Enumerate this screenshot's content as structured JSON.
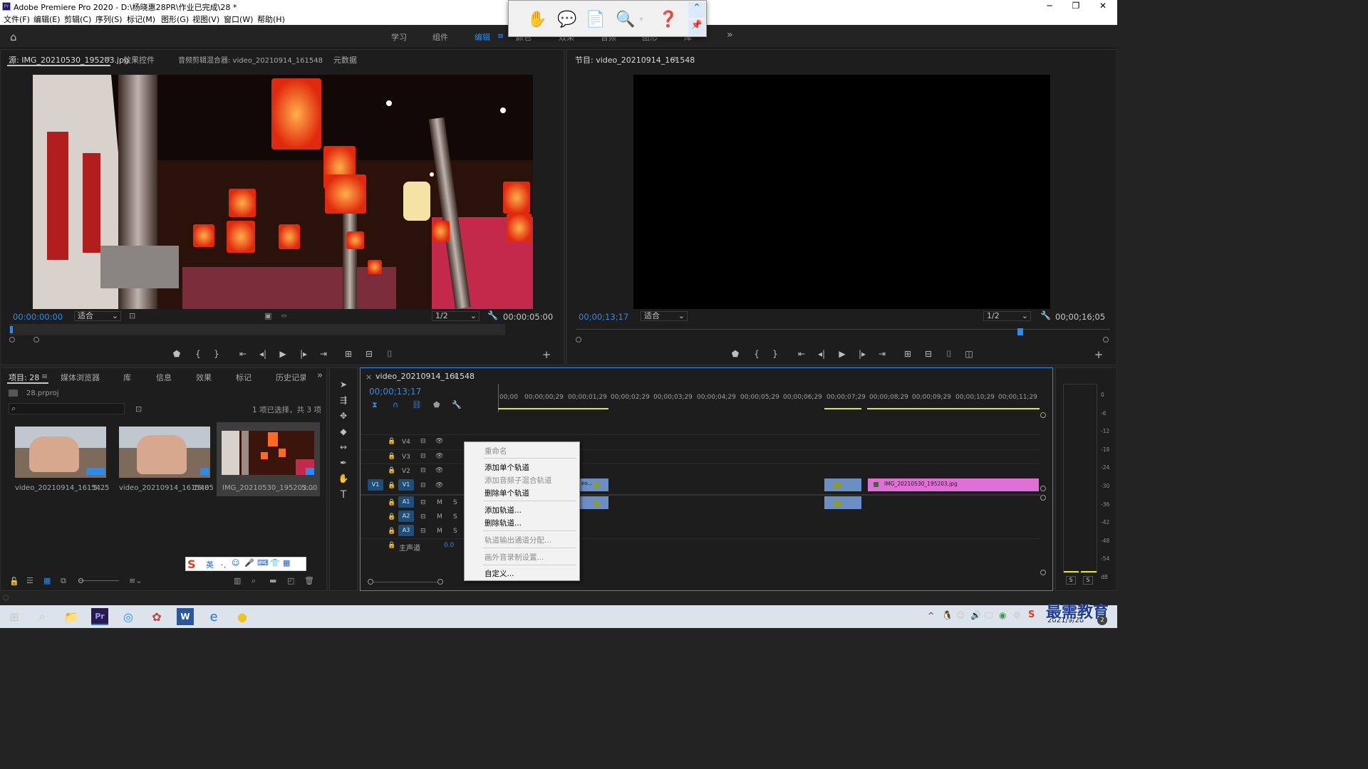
{
  "window": {
    "title": "Adobe Premiere Pro 2020 - D:\\杨晓惠28PR\\作业已完成\\28 *",
    "app_icon": "Pr",
    "minimize": "─",
    "maximize": "❐",
    "close": "✕"
  },
  "menu": [
    "文件(F)",
    "编辑(E)",
    "剪辑(C)",
    "序列(S)",
    "标记(M)",
    "图形(G)",
    "视图(V)",
    "窗口(W)",
    "帮助(H)"
  ],
  "workspaces": {
    "items": [
      "学习",
      "组件",
      "编辑",
      "颜色",
      "效果",
      "音频",
      "图形",
      "库"
    ],
    "active": "编辑",
    "more": "»"
  },
  "source_monitor": {
    "tabs": [
      "源: IMG_20210530_195203.jpg",
      "效果控件",
      "音频剪辑混合器: video_20210914_161548",
      "元数据"
    ],
    "timecode": "00:00:00:00",
    "fit": "适合",
    "resolution": "1/2",
    "duration": "00:00:05:00"
  },
  "program_monitor": {
    "tab": "节目: video_20210914_161548",
    "timecode": "00;00;13;17",
    "fit": "适合",
    "resolution": "1/2",
    "duration": "00;00;16;05"
  },
  "project": {
    "tabs": [
      "项目: 28",
      "媒体浏览器",
      "库",
      "信息",
      "效果",
      "标记",
      "历史记录"
    ],
    "file": "28.prproj",
    "search_placeholder": "",
    "selection_info": "1 项已选择，共 3 项",
    "items": [
      {
        "name": "video_20210914_16154...",
        "duration": "5;25"
      },
      {
        "name": "video_20210914_161548",
        "duration": "16;05"
      },
      {
        "name": "IMG_20210530_195203...",
        "duration": "5:00"
      }
    ]
  },
  "ime_bar": {
    "logo": "S",
    "lang": "英",
    "icons": [
      "･,",
      "☺",
      "🎤",
      "⌨",
      "👕",
      "▦"
    ]
  },
  "timeline": {
    "tab": "video_20210914_161548",
    "timecode": "00;00;13;17",
    "ruler": [
      "00;00",
      "00;00;00;29",
      "00;00;01;29",
      "00;00;02;29",
      "00;00;03;29",
      "00;00;04;29",
      "00;00;05;29",
      "00;00;06;29",
      "00;00;07;29",
      "00;00;08;29",
      "00;00;09;29",
      "00;00;10;29",
      "00;00;11;29"
    ],
    "video_tracks": [
      "V4",
      "V3",
      "V2",
      "V1"
    ],
    "audio_tracks": [
      "A1",
      "A2",
      "A3"
    ],
    "source_patch": "V1",
    "mute": "M",
    "solo": "S",
    "master_label": "主声道",
    "master_value": "0.0",
    "clip_label": "IMG_20210530_195203.jpg",
    "clip_short": "eo..."
  },
  "context_menu": [
    {
      "label": "重命名",
      "disabled": true
    },
    {
      "label": "添加单个轨道",
      "disabled": false
    },
    {
      "label": "添加音频子混合轨道",
      "disabled": true
    },
    {
      "label": "删除单个轨道",
      "disabled": false
    },
    {
      "label": "添加轨道...",
      "disabled": false
    },
    {
      "label": "删除轨道...",
      "disabled": false
    },
    {
      "label": "轨道输出通道分配...",
      "disabled": true
    },
    {
      "label": "画外音录制设置...",
      "disabled": true
    },
    {
      "label": "自定义...",
      "disabled": false
    }
  ],
  "audio_meter": {
    "scale": [
      "0",
      "-6",
      "-12",
      "-18",
      "-24",
      "-30",
      "-36",
      "-42",
      "-48",
      "-54",
      "dB"
    ],
    "solo_left": "S",
    "solo_right": "S"
  },
  "taskbar": {
    "date": "2021/9/28",
    "watermark": "最需教育",
    "notification_count": "2"
  },
  "colors": {
    "accent": "#2d8ceb",
    "clip_pink": "#e06fd8",
    "clip_blue": "#6b8fc4",
    "work_area_yellow": "#e5e520",
    "panel_bg": "#1d1d1d"
  }
}
